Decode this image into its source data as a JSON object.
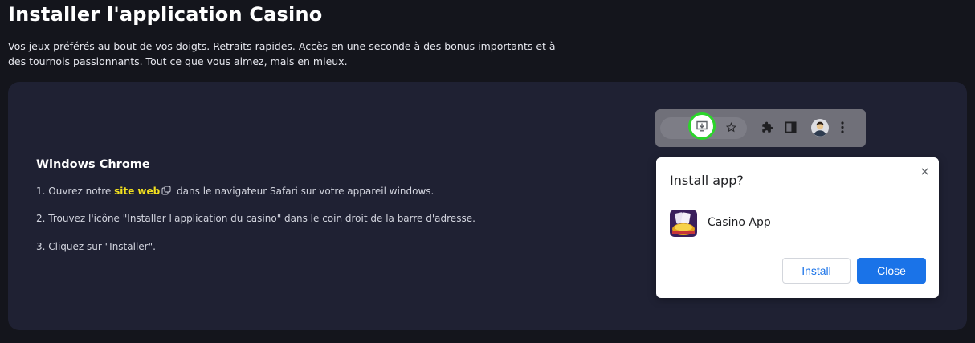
{
  "header": {
    "title": "Installer l'application Casino",
    "subtitle": "Vos jeux préférés au bout de vos doigts. Retraits rapides. Accès en une seconde à des bonus importants et à des tournois passionnants. Tout ce que vous aimez, mais en mieux."
  },
  "instructions": {
    "heading": "Windows Chrome",
    "step1_prefix": "1. Ouvrez notre ",
    "step1_link": "site web",
    "step1_suffix": " dans le navigateur Safari sur votre appareil windows.",
    "step2": "2. Trouvez l'icône \"Installer l'application du casino\" dans le coin droit de la barre d'adresse.",
    "step3": "3. Cliquez sur \"Installer\"."
  },
  "browser_toolbar": {
    "icons": [
      "install-app-icon",
      "star-icon",
      "puzzle-icon",
      "side-panel-icon",
      "profile-avatar",
      "kebab-menu-icon"
    ]
  },
  "install_dialog": {
    "title": "Install app?",
    "app_name": "Casino App",
    "install_label": "Install",
    "close_label": "Close",
    "close_icon": "close-icon"
  },
  "colors": {
    "background": "#14151c",
    "card": "#1f2133",
    "link": "#f3e11f",
    "highlight_ring": "#2bd52a",
    "primary_button": "#1a73e8"
  }
}
